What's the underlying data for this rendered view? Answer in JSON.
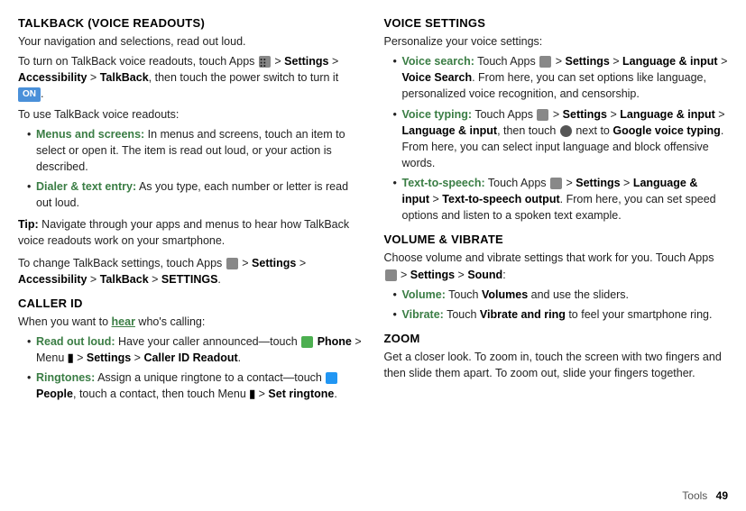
{
  "left": {
    "talkback_title": "TALKBACK (VOICE READOUTS)",
    "talkback_intro": "Your navigation and selections, read out loud.",
    "talkback_p1_pre": "To turn on TalkBack voice readouts, touch Apps",
    "talkback_p1_mid": "> Settings > Accessibility > TalkBack, then touch the power switch to turn it",
    "talkback_p1_on": "ON",
    "talkback_p2": "To use TalkBack voice readouts:",
    "bullets1": [
      {
        "label": "Menus and screens:",
        "text": "In menus and screens, touch an item to select or open it. The item is read out loud, or your action is described."
      },
      {
        "label": "Dialer & text entry:",
        "text": "As you type, each number or letter is read out loud."
      }
    ],
    "tip_label": "Tip:",
    "tip_text": "Navigate through your apps and menus to hear how TalkBack voice readouts work on your smartphone.",
    "talkback_p3_pre": "To change TalkBack settings, touch Apps",
    "talkback_p3_mid": "> Settings > Accessibility > TalkBack >",
    "talkback_p3_settings": "SETTINGS",
    "caller_id_title": "CALLER ID",
    "caller_id_intro": "When you want to",
    "caller_id_hear": "hear",
    "caller_id_intro2": "who's calling:",
    "bullets2": [
      {
        "label": "Read out loud:",
        "text": "Have your caller announced—touch",
        "extra": "Phone > Menu > Settings > Caller ID Readout."
      },
      {
        "label": "Ringtones:",
        "text": "Assign a unique ringtone to a contact—touch",
        "extra": "People",
        "extra2": ", touch a contact, then touch Menu > Set ringtone."
      }
    ]
  },
  "right": {
    "voice_title": "VOICE SETTINGS",
    "voice_intro": "Personalize your voice settings:",
    "voice_bullets": [
      {
        "label": "Voice search:",
        "text": "Touch Apps > Settings > Language & input > Voice Search. From here, you can set options like language, personalized voice recognition, and censorship."
      },
      {
        "label": "Voice typing:",
        "text": "Touch Apps > Settings > Language & input > Language & input, then touch",
        "extra": "next to Google voice typing. From here, you can select input language and block offensive words."
      },
      {
        "label": "Text-to-speech:",
        "text": "Touch Apps > Settings > Language & input > Text-to-speech output. From here, you can set speed options and listen to a spoken text example."
      }
    ],
    "volume_title": "VOLUME & VIBRATE",
    "volume_intro": "Choose volume and vibrate settings that work for you. Touch Apps > Settings > Sound:",
    "volume_bullets": [
      {
        "label": "Volume:",
        "text": "Touch Volumes and use the sliders."
      },
      {
        "label": "Vibrate:",
        "text": "Touch Vibrate and ring to feel your smartphone ring."
      }
    ],
    "zoom_title": "ZOOM",
    "zoom_text": "Get a closer look. To zoom in, touch the screen with two fingers and then slide them apart. To zoom out, slide your fingers together."
  },
  "footer": {
    "label": "Tools",
    "page_number": "49"
  }
}
